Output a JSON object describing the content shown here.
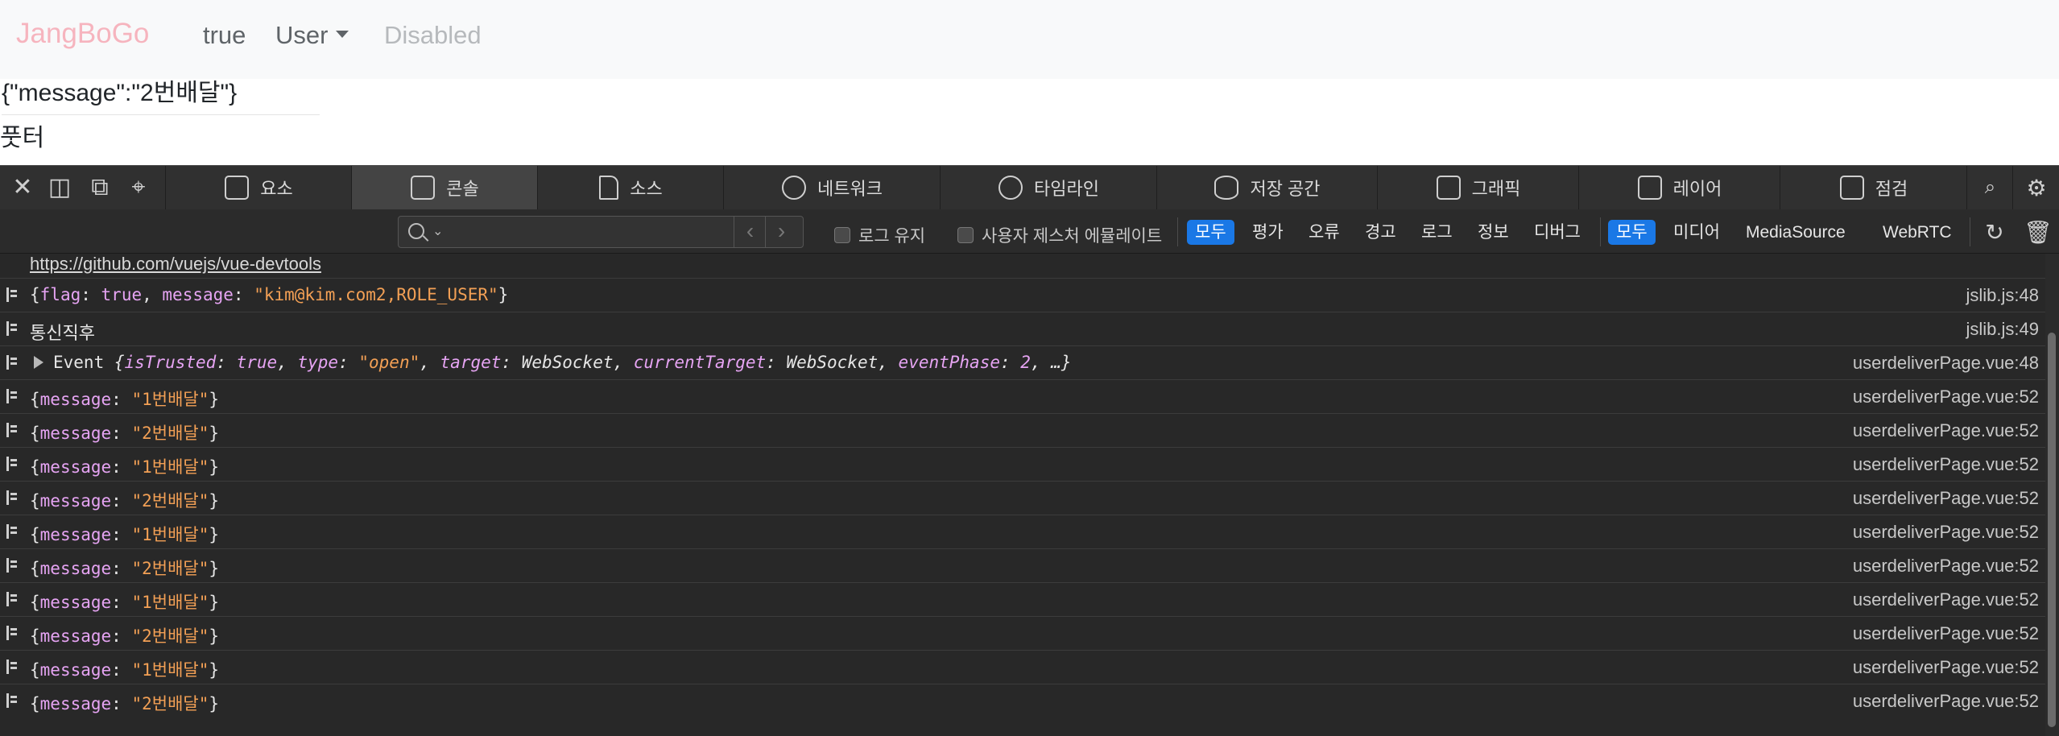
{
  "navbar": {
    "brand": "JangBoGo",
    "links": [
      "true",
      "User",
      "Disabled"
    ]
  },
  "page": {
    "json_text": "{\"message\":\"2번배달\"}",
    "footer": "풋터"
  },
  "devtools": {
    "tabs": [
      "요소",
      "콘솔",
      "소스",
      "네트워크",
      "타임라인",
      "저장 공간",
      "그래픽",
      "레이어",
      "점검"
    ],
    "selected_tab": "콘솔",
    "filter": {
      "search_placeholder": "",
      "preserve_log": "로그 유지",
      "user_gesture": "사용자 제스처 에뮬레이트",
      "level_buttons": [
        "모두",
        "평가",
        "오류",
        "경고",
        "로그",
        "정보",
        "디버그"
      ],
      "source_buttons": [
        "모두",
        "미디어",
        "MediaSource",
        "WebRTC"
      ]
    },
    "console": {
      "link": "https://github.com/vuejs/vue-devtools",
      "rows": [
        {
          "type": "obj1",
          "src": "jslib.js:48",
          "parts": {
            "k1": "flag",
            "v1": "true",
            "k2": "message",
            "v2": "\"kim@kim.com2,ROLE_USER\""
          }
        },
        {
          "type": "plain",
          "src": "jslib.js:49",
          "text": "통신직후"
        },
        {
          "type": "event",
          "src": "userdeliverPage.vue:48",
          "parts": {
            "name": "Event",
            "k1": "isTrusted",
            "v1": "true",
            "k2": "type",
            "v2": "\"open\"",
            "k3": "target",
            "v3": "WebSocket",
            "k4": "currentTarget",
            "v4": "WebSocket",
            "k5": "eventPhase",
            "v5": "2",
            "rest": ", …}"
          }
        },
        {
          "type": "msg",
          "src": "userdeliverPage.vue:52",
          "value": "\"1번배달\""
        },
        {
          "type": "msg",
          "src": "userdeliverPage.vue:52",
          "value": "\"2번배달\""
        },
        {
          "type": "msg",
          "src": "userdeliverPage.vue:52",
          "value": "\"1번배달\""
        },
        {
          "type": "msg",
          "src": "userdeliverPage.vue:52",
          "value": "\"2번배달\""
        },
        {
          "type": "msg",
          "src": "userdeliverPage.vue:52",
          "value": "\"1번배달\""
        },
        {
          "type": "msg",
          "src": "userdeliverPage.vue:52",
          "value": "\"2번배달\""
        },
        {
          "type": "msg",
          "src": "userdeliverPage.vue:52",
          "value": "\"1번배달\""
        },
        {
          "type": "msg",
          "src": "userdeliverPage.vue:52",
          "value": "\"2번배달\""
        },
        {
          "type": "msg",
          "src": "userdeliverPage.vue:52",
          "value": "\"1번배달\""
        },
        {
          "type": "msg",
          "src": "userdeliverPage.vue:52",
          "value": "\"2번배달\""
        }
      ]
    }
  },
  "colors": {
    "brand": "#f6b4be",
    "devtools_bg": "#282828",
    "active_filter": "#1a78e6",
    "string": "#f3a055",
    "key": "#e6a4f3"
  }
}
